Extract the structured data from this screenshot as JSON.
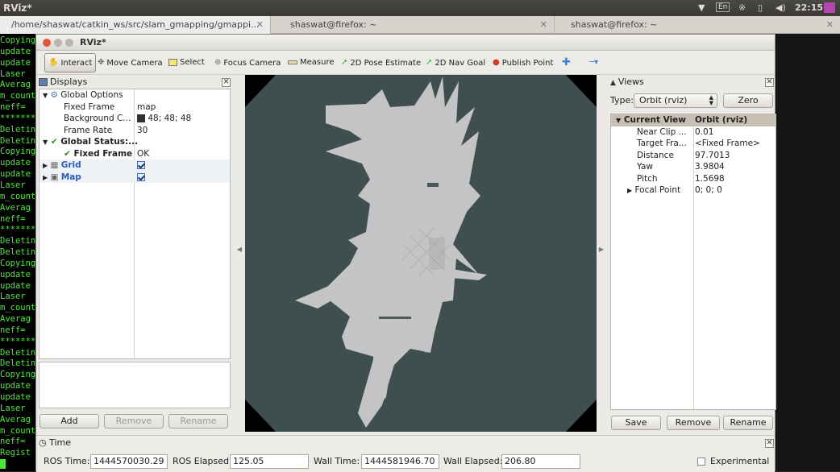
{
  "topbar": {
    "app_title": "RViz*",
    "lang": "En",
    "clock": "22:15"
  },
  "terminal_tabs": [
    {
      "label": "/home/shaswat/catkin_ws/src/slam_gmapping/gmappi..."
    },
    {
      "label": "shaswat@firefox: ~"
    },
    {
      "label": "shaswat@firefox: ~"
    }
  ],
  "terminal_lines": [
    "Copying",
    "update",
    "update",
    "Laser ",
    "Averag",
    "m_count",
    "neff= ",
    "*******",
    "Deletin",
    "Deletin",
    "Copying",
    "update",
    "update",
    "Laser ",
    "m_count",
    "Averag",
    "neff= ",
    "*******",
    "Deletin",
    "Deletin",
    "Copying",
    "update",
    "update",
    "Laser ",
    "m_count",
    "Averag",
    "neff= ",
    "*******",
    "Deletin",
    "Deletin",
    "Copying",
    "update",
    "update",
    "Laser ",
    "Averag",
    "m_count",
    "neff= ",
    "Regist"
  ],
  "window": {
    "title": "RViz*"
  },
  "toolbar": {
    "interact": "Interact",
    "move_camera": "Move Camera",
    "select": "Select",
    "focus_camera": "Focus Camera",
    "measure": "Measure",
    "pose_estimate": "2D Pose Estimate",
    "nav_goal": "2D Nav Goal",
    "publish_point": "Publish Point"
  },
  "displays": {
    "title": "Displays",
    "global_options": "Global Options",
    "fixed_frame_label": "Fixed Frame",
    "fixed_frame_value": "map",
    "bg_color_label": "Background C...",
    "bg_color_value": "48; 48; 48",
    "frame_rate_label": "Frame Rate",
    "frame_rate_value": "30",
    "global_status": "Global Status:...",
    "status_fixed_frame": "Fixed Frame",
    "status_ok": "OK",
    "grid": "Grid",
    "map": "Map",
    "add": "Add",
    "remove": "Remove",
    "rename": "Rename"
  },
  "views": {
    "title": "Views",
    "type_label": "Type:",
    "type_value": "Orbit (rviz)",
    "zero": "Zero",
    "current_view": "Current View",
    "current_view_value": "Orbit (rviz)",
    "props": [
      {
        "name": "Near Clip ...",
        "value": "0.01"
      },
      {
        "name": "Target Fra...",
        "value": "<Fixed Frame>"
      },
      {
        "name": "Distance",
        "value": "97.7013"
      },
      {
        "name": "Yaw",
        "value": "3.9804"
      },
      {
        "name": "Pitch",
        "value": "1.5698"
      },
      {
        "name": "Focal Point",
        "value": "0; 0; 0"
      }
    ],
    "save": "Save",
    "remove": "Remove",
    "rename": "Rename"
  },
  "time": {
    "title": "Time",
    "ros_time_label": "ROS Time:",
    "ros_time": "1444570030.29",
    "ros_elapsed_label": "ROS Elapsed:",
    "ros_elapsed": "125.05",
    "wall_time_label": "Wall Time:",
    "wall_time": "1444581946.70",
    "wall_elapsed_label": "Wall Elapsed:",
    "wall_elapsed": "206.80",
    "experimental": "Experimental"
  },
  "colors": {
    "background": "#3f4f50",
    "map_free": "#c4c4c4",
    "terminal_text": "#4ee83a"
  }
}
